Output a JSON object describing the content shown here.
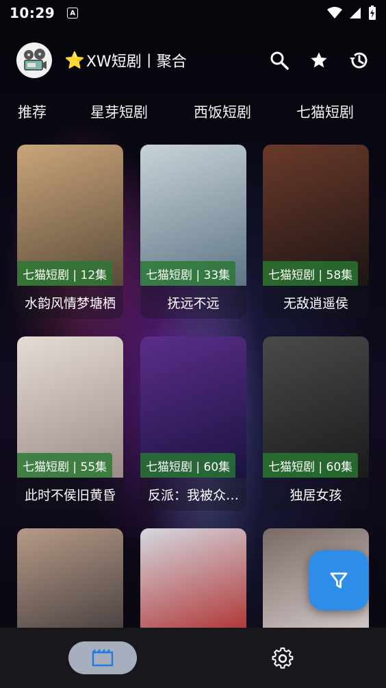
{
  "status_bar": {
    "time": "10:29",
    "notification_icon": "A"
  },
  "header": {
    "star": "⭐",
    "title": "XW短剧丨聚合",
    "icons": [
      "search-icon",
      "star-icon",
      "history-icon"
    ]
  },
  "tabs": [
    "推荐",
    "星芽短剧",
    "西饭短剧",
    "七猫短剧"
  ],
  "cards": [
    {
      "tag": "七猫短剧 | 12集",
      "title": "水韵风情梦塘栖",
      "colors": [
        "#caa57a",
        "#5a4a3a"
      ]
    },
    {
      "tag": "七猫短剧 | 33集",
      "title": "抚远不远",
      "colors": [
        "#c8d3d8",
        "#5e7585"
      ]
    },
    {
      "tag": "七猫短剧 | 58集",
      "title": "无敌逍遥侯",
      "colors": [
        "#6a3a2a",
        "#1d1414"
      ]
    },
    {
      "tag": "七猫短剧 | 55集",
      "title": "此时不侯旧黄昏",
      "colors": [
        "#e5dcd6",
        "#9b8a85"
      ]
    },
    {
      "tag": "七猫短剧 | 60集",
      "title": "反派：我被众…",
      "colors": [
        "#5a2e8a",
        "#1b1340"
      ]
    },
    {
      "tag": "七猫短剧 | 60集",
      "title": "独居女孩",
      "colors": [
        "#4a4a4a",
        "#1a1a1a"
      ]
    },
    {
      "tag": "",
      "title": "",
      "colors": [
        "#b79a86",
        "#4c4444"
      ]
    },
    {
      "tag": "",
      "title": "",
      "colors": [
        "#d5d8e0",
        "#b03a3a"
      ]
    },
    {
      "tag": "",
      "title": "",
      "colors": [
        "#7a6a66",
        "#cfc6c4"
      ]
    }
  ],
  "fab": {
    "icon": "filter-icon"
  },
  "bottom_nav": [
    "video-icon",
    "settings-icon"
  ],
  "accent": "#2e8de6",
  "tag_color": "#287832"
}
